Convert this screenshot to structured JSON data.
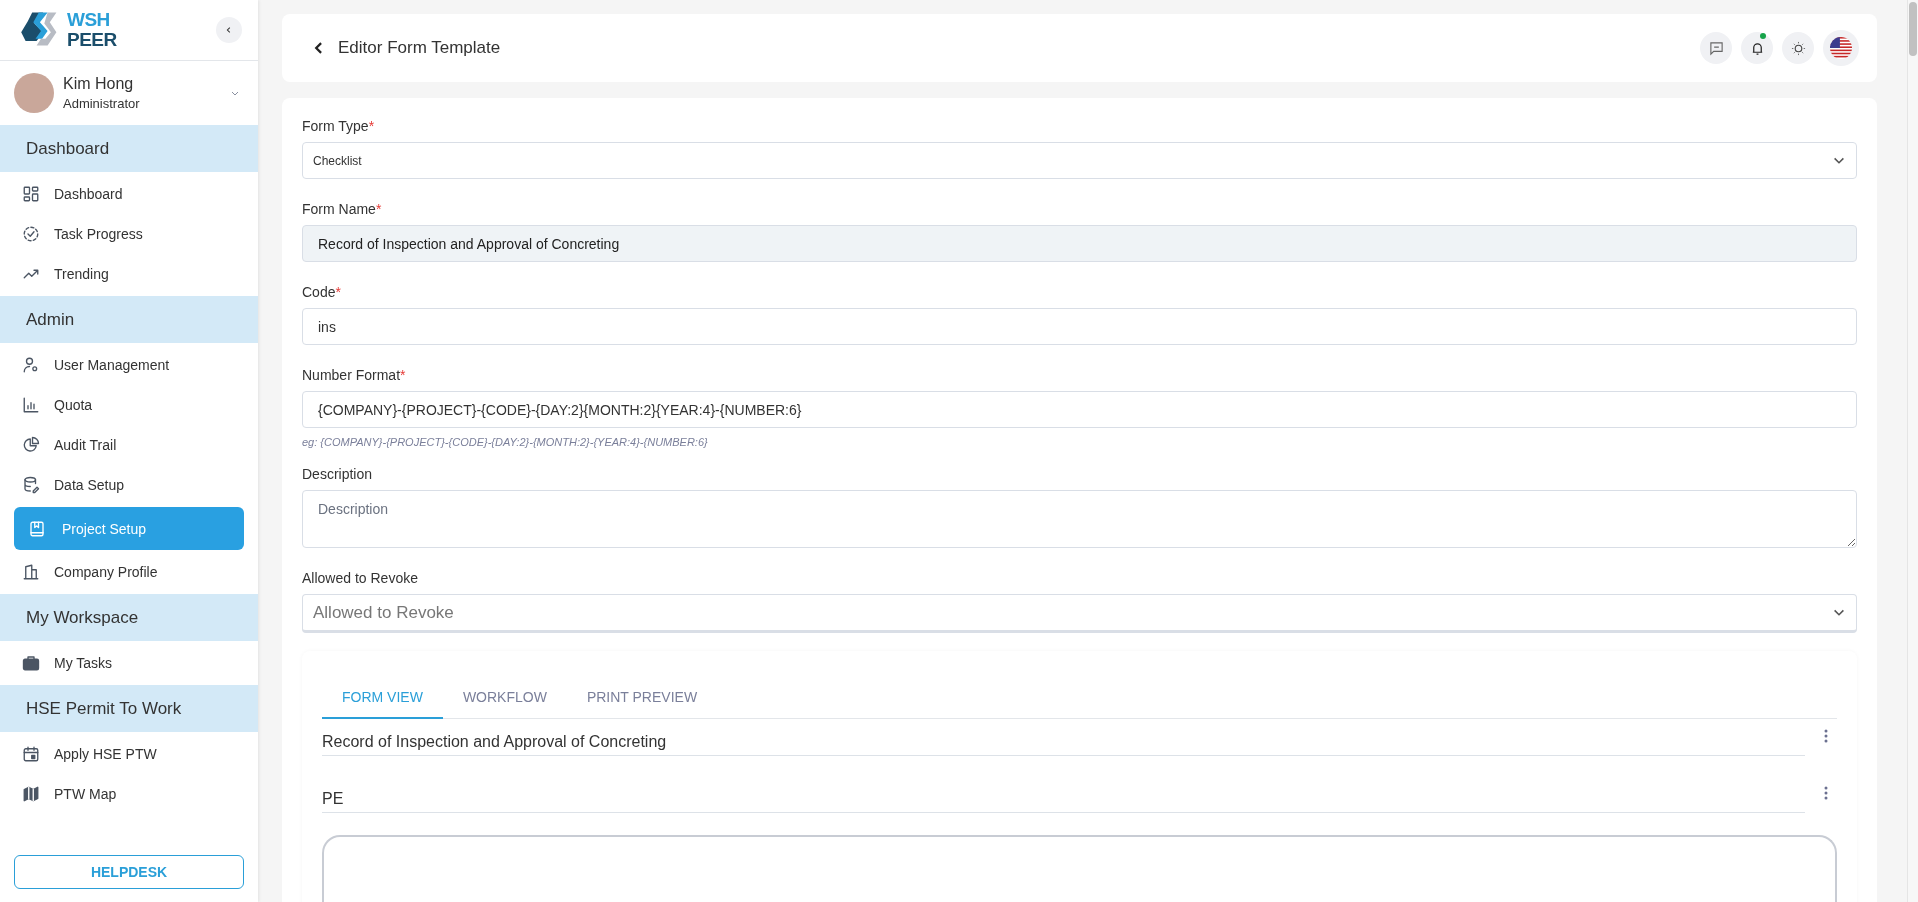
{
  "sidebar": {
    "logo": {
      "line_1": "WSH",
      "line_2": "PEER"
    },
    "user": {
      "name": "Kim Hong",
      "role": "Administrator"
    },
    "sections": [
      {
        "title": "Dashboard",
        "items": [
          {
            "label": "Dashboard",
            "selected": false
          },
          {
            "label": "Task Progress",
            "selected": false
          },
          {
            "label": "Trending",
            "selected": false
          }
        ]
      },
      {
        "title": "Admin",
        "items": [
          {
            "label": "User Management",
            "selected": false
          },
          {
            "label": "Quota",
            "selected": false
          },
          {
            "label": "Audit Trail",
            "selected": false
          },
          {
            "label": "Data Setup",
            "selected": false
          },
          {
            "label": "Project Setup",
            "selected": true
          },
          {
            "label": "Company Profile",
            "selected": false
          }
        ]
      },
      {
        "title": "My Workspace",
        "items": [
          {
            "label": "My Tasks",
            "selected": false
          }
        ]
      },
      {
        "title": "HSE Permit To Work",
        "items": [
          {
            "label": "Apply HSE PTW",
            "selected": false
          },
          {
            "label": "PTW Map",
            "selected": false
          }
        ]
      }
    ],
    "helpdesk": "HELPDESK"
  },
  "header": {
    "title": "Editor Form Template",
    "notification_unread": true
  },
  "form": {
    "fields": [
      {
        "kind": "select",
        "label": "Form Type",
        "required_mark": "*",
        "value": "Checklist"
      },
      {
        "kind": "text",
        "label": "Form Name",
        "required_mark": "*",
        "value": "Record of Inspection and Approval of Concreting",
        "readonly": true
      },
      {
        "kind": "text",
        "label": "Code",
        "required_mark": "*",
        "value": "ins",
        "readonly": false
      },
      {
        "kind": "text",
        "label": "Number Format",
        "required_mark": "*",
        "value": "{COMPANY}-{PROJECT}-{CODE}-{DAY:2}{MONTH:2}{YEAR:4}-{NUMBER:6}",
        "hint": "eg: {COMPANY}-{PROJECT}-{CODE}-{DAY:2}-{MONTH:2}-{YEAR:4}-{NUMBER:6}",
        "readonly": false
      },
      {
        "kind": "textarea",
        "label": "Description",
        "placeholder": "Description"
      },
      {
        "kind": "multiselect",
        "label": "Allowed to Revoke",
        "placeholder": "Allowed to Revoke"
      }
    ]
  },
  "builder": {
    "tabs": [
      {
        "label": "FORM VIEW",
        "selected": true
      },
      {
        "label": "WORKFLOW",
        "selected": false
      },
      {
        "label": "PRINT PREVIEW",
        "selected": false
      }
    ],
    "rows": [
      {
        "title": "Record of Inspection and Approval of Concreting"
      },
      {
        "title": "PE"
      }
    ]
  }
}
